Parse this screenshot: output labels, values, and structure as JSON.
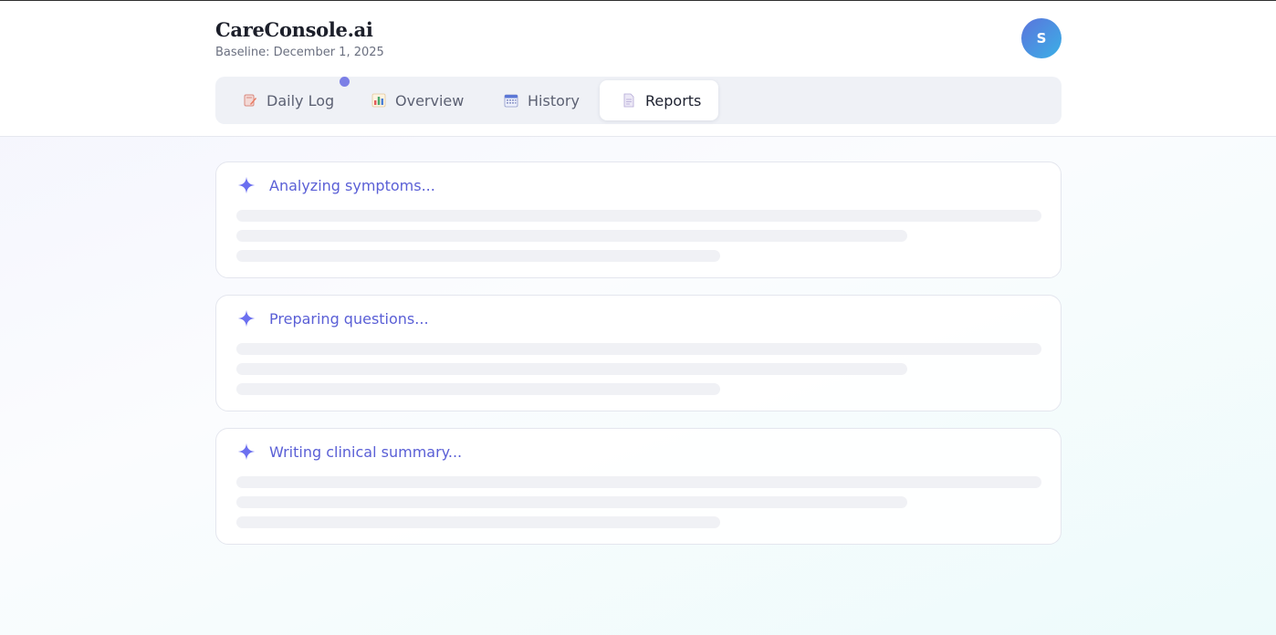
{
  "app": {
    "brand": "CareConsole.ai",
    "baseline": "Baseline: December 1, 2025",
    "avatar_initial": "S"
  },
  "tabs": [
    {
      "label": "Daily Log",
      "icon": "notepad-pencil-icon",
      "active": false
    },
    {
      "label": "Overview",
      "icon": "bar-chart-icon",
      "active": false
    },
    {
      "label": "History",
      "icon": "calendar-icon",
      "active": false
    },
    {
      "label": "Reports",
      "icon": "document-icon",
      "active": true
    }
  ],
  "cards": [
    {
      "title": "Analyzing symptoms...",
      "icon": "sparkle-icon"
    },
    {
      "title": "Preparing questions...",
      "icon": "sparkle-icon"
    },
    {
      "title": "Writing clinical summary...",
      "icon": "sparkle-icon"
    }
  ],
  "colors": {
    "accent": "#5a5fd6",
    "sparkle": "#6b6ff0",
    "indicator_dot": "#7b7fe6",
    "skeleton": "#f0f1f5"
  }
}
